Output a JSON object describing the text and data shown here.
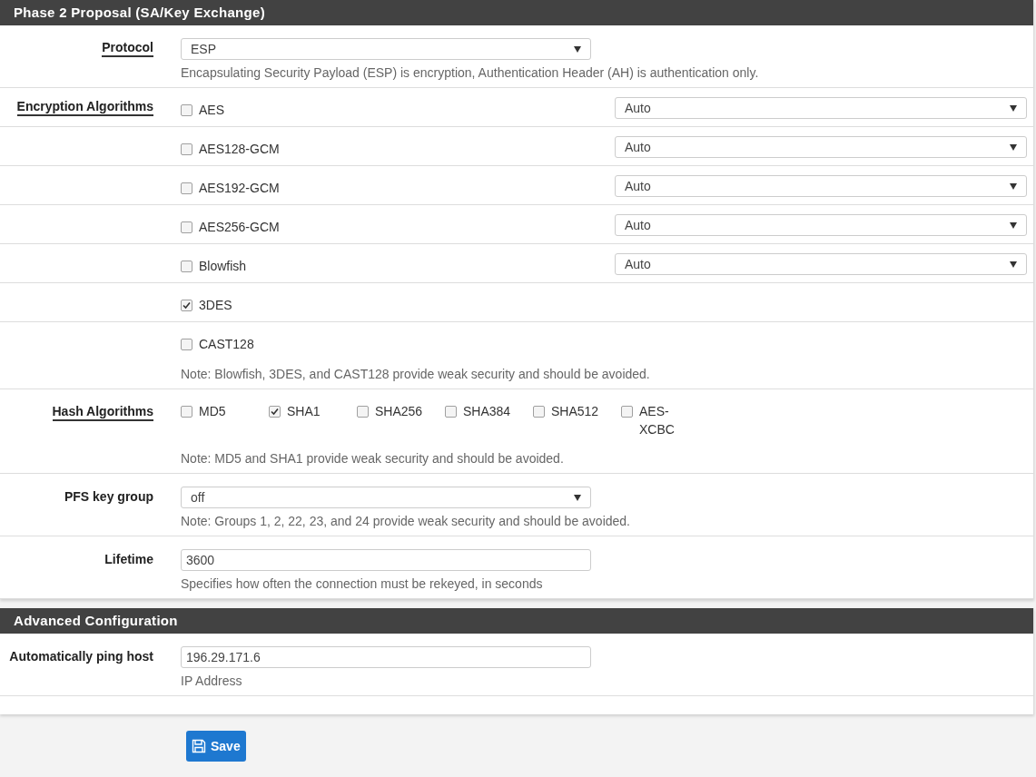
{
  "panels": [
    {
      "title": "Phase 2 Proposal (SA/Key Exchange)",
      "rows": [
        {
          "kind": "select",
          "label": "Protocol",
          "help": true,
          "value": "ESP",
          "note": "Encapsulating Security Payload (ESP) is encryption, Authentication Header (AH) is authentication only."
        },
        {
          "kind": "algo",
          "label": "Encryption Algorithms",
          "help": true,
          "name": "AES",
          "checked": false,
          "keylen": "Auto"
        },
        {
          "kind": "algo",
          "name": "AES128-GCM",
          "checked": false,
          "keylen": "Auto"
        },
        {
          "kind": "algo",
          "name": "AES192-GCM",
          "checked": false,
          "keylen": "Auto"
        },
        {
          "kind": "algo",
          "name": "AES256-GCM",
          "checked": false,
          "keylen": "Auto"
        },
        {
          "kind": "algo",
          "name": "Blowfish",
          "checked": false,
          "keylen": "Auto"
        },
        {
          "kind": "algo",
          "name": "3DES",
          "checked": true
        },
        {
          "kind": "algo",
          "name": "CAST128",
          "checked": false,
          "note": "Note: Blowfish, 3DES, and CAST128 provide weak security and should be avoided."
        },
        {
          "kind": "checks",
          "label": "Hash Algorithms",
          "help": true,
          "options": [
            {
              "name": "MD5",
              "checked": false
            },
            {
              "name": "SHA1",
              "checked": true
            },
            {
              "name": "SHA256",
              "checked": false
            },
            {
              "name": "SHA384",
              "checked": false
            },
            {
              "name": "SHA512",
              "checked": false
            },
            {
              "name": "AES-XCBC",
              "checked": false
            }
          ],
          "note": "Note: MD5 and SHA1 provide weak security and should be avoided."
        },
        {
          "kind": "select",
          "label": "PFS key group",
          "help": false,
          "value": "off",
          "note": "Note: Groups 1, 2, 22, 23, and 24 provide weak security and should be avoided."
        },
        {
          "kind": "input",
          "label": "Lifetime",
          "help": false,
          "value": "3600",
          "note": "Specifies how often the connection must be rekeyed, in seconds"
        }
      ]
    },
    {
      "title": "Advanced Configuration",
      "rows": [
        {
          "kind": "input",
          "label": "Automatically ping host",
          "help": false,
          "value": "196.29.171.6",
          "note": "IP Address"
        },
        {
          "kind": "blank"
        }
      ]
    }
  ],
  "save": "Save"
}
